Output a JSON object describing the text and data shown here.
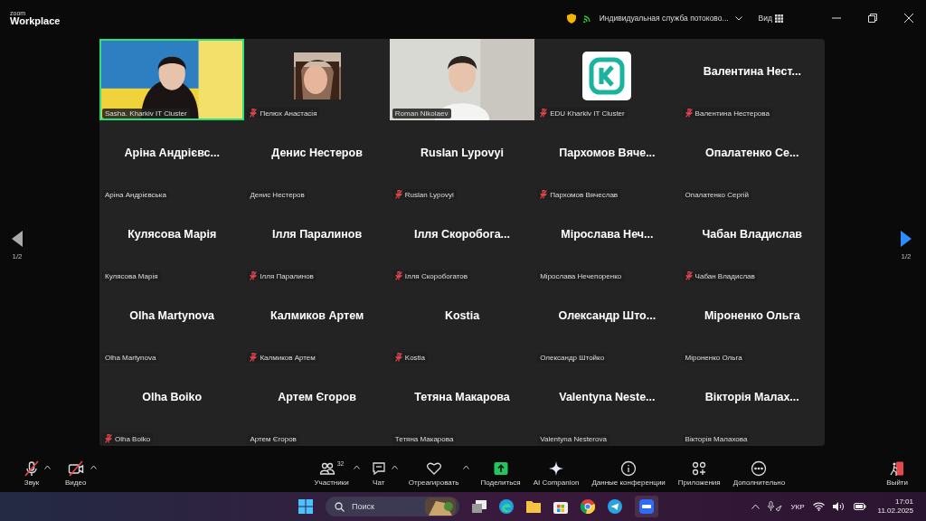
{
  "window": {
    "brand_top": "zoom",
    "brand": "Workplace",
    "stream": "Индивидуальная служба потоково...",
    "view": "Вид"
  },
  "pager": {
    "left": "1/2",
    "right": "1/2"
  },
  "tiles": [
    {
      "kind": "video",
      "label": "Sasha. Kharkiv IT Cluster",
      "muted": false,
      "speaking": true
    },
    {
      "kind": "avatar",
      "label": "Пелюх Анастасія",
      "muted": true,
      "speaking": false
    },
    {
      "kind": "video",
      "label": "Roman Nikolaev",
      "muted": false,
      "speaking": false
    },
    {
      "kind": "logo",
      "label": "EDU Kharkiv IT Cluster",
      "muted": true,
      "speaking": false
    },
    {
      "kind": "name",
      "name": "Валентина  Нест...",
      "label": "Валентина Нестерова",
      "muted": true,
      "speaking": false
    },
    {
      "kind": "name",
      "name": "Аріна  Андрієвс...",
      "label": "Аріна Андрієвська",
      "muted": false,
      "speaking": false
    },
    {
      "kind": "name",
      "name": "Денис Нестеров",
      "label": "Денис Нестеров",
      "muted": false,
      "speaking": false
    },
    {
      "kind": "name",
      "name": "Ruslan Lypovyi",
      "label": "Ruslan Lypovyi",
      "muted": true,
      "speaking": false
    },
    {
      "kind": "name",
      "name": "Пархомов  Вяче...",
      "label": "Пархомов Вячеслав",
      "muted": true,
      "speaking": false
    },
    {
      "kind": "name",
      "name": "Опалатенко  Се...",
      "label": "Опалатенко Сергій",
      "muted": false,
      "speaking": false
    },
    {
      "kind": "name",
      "name": "Кулясова Марія",
      "label": "Кулясова Марія",
      "muted": false,
      "speaking": false
    },
    {
      "kind": "name",
      "name": "Ілля Паралинов",
      "label": "Ілля Паралинов",
      "muted": true,
      "speaking": false
    },
    {
      "kind": "name",
      "name": "Ілля  Скоробога...",
      "label": "Ілля Скоробогатов",
      "muted": true,
      "speaking": false
    },
    {
      "kind": "name",
      "name": "Мірослава  Неч...",
      "label": "Мірослава Нечепоренко",
      "muted": false,
      "speaking": false
    },
    {
      "kind": "name",
      "name": "Чабан Владислав",
      "label": "Чабан Владислав",
      "muted": true,
      "speaking": false
    },
    {
      "kind": "name",
      "name": "Olha Martynova",
      "label": "Olha Martynova",
      "muted": false,
      "speaking": false
    },
    {
      "kind": "name",
      "name": "Калмиков Артем",
      "label": "Калмиков Артем",
      "muted": true,
      "speaking": false
    },
    {
      "kind": "name",
      "name": "Kostia",
      "label": "Kostia",
      "muted": true,
      "speaking": false
    },
    {
      "kind": "name",
      "name": "Олександр  Што...",
      "label": "Олександр Штойко",
      "muted": false,
      "speaking": false
    },
    {
      "kind": "name",
      "name": "Міроненко Ольга",
      "label": "Міроненко Ольга",
      "muted": false,
      "speaking": false
    },
    {
      "kind": "name",
      "name": "Olha Boiko",
      "label": "Olha Boiko",
      "muted": true,
      "speaking": false
    },
    {
      "kind": "name",
      "name": "Артем Єгоров",
      "label": "Артем Єгоров",
      "muted": false,
      "speaking": false
    },
    {
      "kind": "name",
      "name": "Тетяна Макарова",
      "label": "Тетяна Макарова",
      "muted": false,
      "speaking": false
    },
    {
      "kind": "name",
      "name": "Valentyna  Neste...",
      "label": "Valentyna Nesterova",
      "muted": false,
      "speaking": false
    },
    {
      "kind": "name",
      "name": "Вікторія  Малах...",
      "label": "Вікторія Малахова",
      "muted": false,
      "speaking": false
    }
  ],
  "toolbar_left": [
    {
      "kind": "mic",
      "label": "Звук",
      "caret": true,
      "off": true
    },
    {
      "kind": "camera",
      "label": "Видео",
      "caret": true,
      "off": true
    }
  ],
  "toolbar_center": [
    {
      "kind": "people",
      "label": "Участники",
      "count": "32",
      "caret": true
    },
    {
      "kind": "chat",
      "label": "Чат",
      "caret": true
    },
    {
      "kind": "heart",
      "label": "Отреагировать",
      "caret": true
    },
    {
      "kind": "share",
      "label": "Поделиться",
      "caret": false
    },
    {
      "kind": "sparkle",
      "label": "AI Companion",
      "caret": false
    },
    {
      "kind": "info",
      "label": "Данные конференции",
      "caret": false
    },
    {
      "kind": "apps",
      "label": "Приложения",
      "caret": false
    },
    {
      "kind": "more",
      "label": "Дополнительно",
      "caret": false
    }
  ],
  "leave": {
    "label": "Выйти"
  },
  "taskbar": {
    "search": {
      "placeholder": "Поиск"
    },
    "language": "УКР",
    "time": "17:01",
    "date": "11.02.2025"
  }
}
